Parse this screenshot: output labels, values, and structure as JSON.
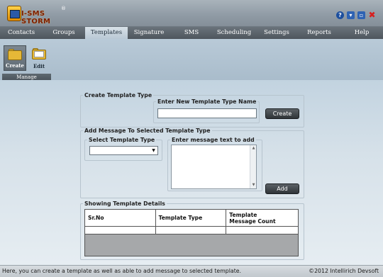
{
  "app": {
    "logo_text": "I-SMS STORM",
    "logo_mark": "®"
  },
  "window_controls": {
    "help_icon": "help-icon",
    "minimize_icon": "minimize-icon",
    "restore_icon": "restore-icon",
    "close_icon": "close-icon",
    "help_glyph": "?",
    "min_glyph": "▾",
    "max_glyph": "▫",
    "close_glyph": "✖"
  },
  "menu": {
    "items": [
      {
        "label": "Contacts"
      },
      {
        "label": "Groups"
      },
      {
        "label": "Templates",
        "active": true
      },
      {
        "label": "Signature"
      },
      {
        "label": "SMS"
      },
      {
        "label": "Scheduling"
      },
      {
        "label": "Settings"
      },
      {
        "label": "Reports"
      },
      {
        "label": "Help"
      }
    ]
  },
  "ribbon": {
    "create_label": "Create",
    "edit_label": "Edit",
    "group_label": "Manage"
  },
  "create_type": {
    "legend": "Create Template Type",
    "inner_legend": "Enter New Template Type Name",
    "input_value": "",
    "button_label": "Create"
  },
  "add_message": {
    "legend": "Add Message To Selected Template Type",
    "select_legend": "Select Template Type",
    "select_value": "",
    "text_legend": "Enter message text to add",
    "text_value": "",
    "button_label": "Add"
  },
  "details": {
    "legend": "Showing Template Details",
    "columns": [
      "Sr.No",
      "Template Type",
      "Template Message Count"
    ],
    "column_line1": "Template",
    "column_line2": "Message Count"
  },
  "status": {
    "text": "Here, you can create a template as well as able to add message to selected template.",
    "copyright": "©2012 Intellirich Devsoft"
  },
  "colors": {
    "menu_bg": "#4e565d",
    "active_tab": "#c9d6e0",
    "button_dark": "#2f3438",
    "close_red": "#d81e1e",
    "logo_orange": "#e08a00"
  }
}
